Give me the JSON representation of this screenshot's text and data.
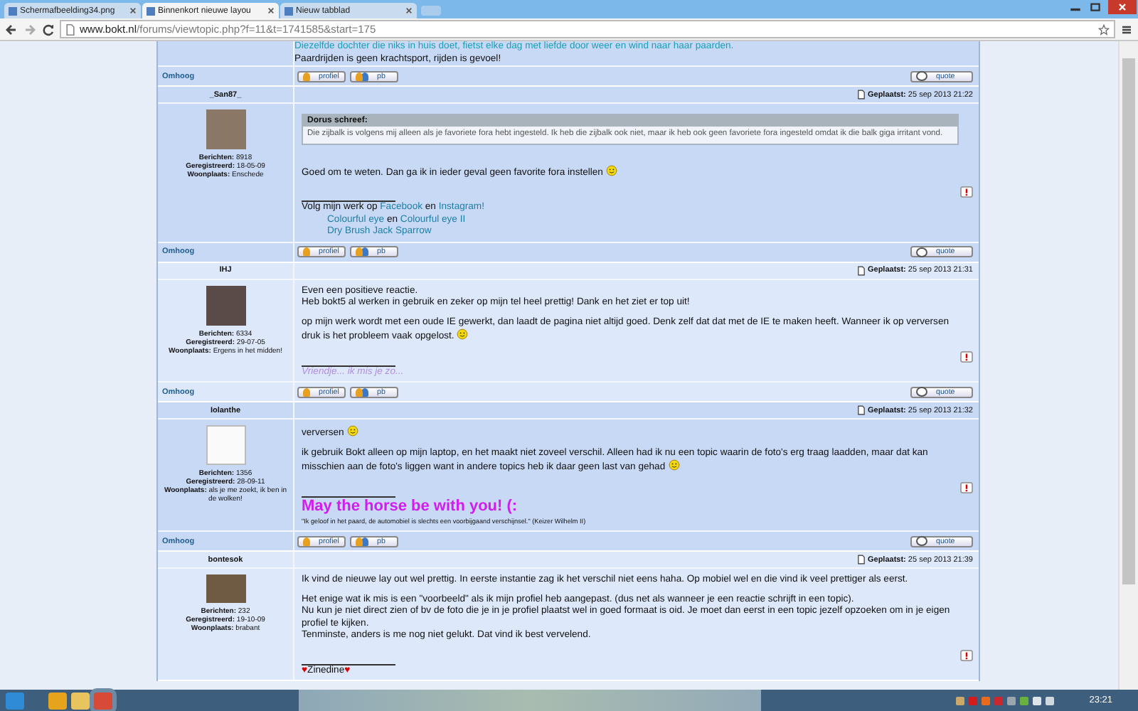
{
  "browser": {
    "tabs": [
      {
        "title": "Schermafbeelding34.png",
        "selected": false
      },
      {
        "title": "Binnenkort nieuwe layou",
        "selected": true
      },
      {
        "title": "Nieuw tabblad",
        "selected": false
      }
    ],
    "url": {
      "host": "www.bokt.nl",
      "path": "/forums/viewtopic.php?f=11&t=1741585&start=175"
    }
  },
  "top_fragment": {
    "signature": [
      [
        {
          "kind": "link",
          "text": "Diezelfde dochter die niks in huis doet, fietst elke dag met liefde door weer en wind naar haar paarden."
        }
      ],
      [
        {
          "kind": "plain",
          "text": "Paardrijden is geen krachtsport, rijden is gevoel!"
        }
      ]
    ],
    "footer": {
      "top_link": "Omhoog",
      "buttons": [
        "profiel",
        "pb"
      ],
      "quote": "quote"
    }
  },
  "posts": [
    {
      "author": "_San87_",
      "posted_label": "Geplaatst:",
      "posted_at": "25 sep 2013 21:22",
      "stats": [
        {
          "label": "Berichten:",
          "value": "8918"
        },
        {
          "label": "Geregistreerd:",
          "value": "18-05-09"
        },
        {
          "label": "Woonplaats:",
          "value": "Enschede"
        }
      ],
      "quote": {
        "header": "Dorus schreef:",
        "text": "Die zijbalk is volgens mij alleen als je favoriete fora hebt ingesteld. Ik heb die zijbalk ook niet, maar ik heb ook geen favoriete fora ingesteld omdat ik die balk giga irritant vond."
      },
      "paragraphs": [
        {
          "text": "Goed om te weten. Dan ga ik in ieder geval geen favorite fora instellen",
          "emoticon": true
        }
      ],
      "signature": [
        [
          {
            "kind": "plain",
            "text": "Volg mijn werk op "
          },
          {
            "kind": "link",
            "text": "Facebook"
          },
          {
            "kind": "plain",
            "text": " en "
          },
          {
            "kind": "link",
            "text": "Instagram!"
          }
        ],
        [
          {
            "kind": "indent"
          },
          {
            "kind": "link",
            "text": "Colourful eye"
          },
          {
            "kind": "plain",
            "text": " en "
          },
          {
            "kind": "link",
            "text": "Colourful eye II"
          }
        ],
        [
          {
            "kind": "indent"
          },
          {
            "kind": "link",
            "text": "Dry Brush Jack Sparrow"
          }
        ]
      ],
      "footer": {
        "top_link": "Omhoog",
        "buttons": [
          "profiel",
          "pb"
        ],
        "quote": "quote"
      }
    },
    {
      "author": "IHJ",
      "posted_label": "Geplaatst:",
      "posted_at": "25 sep 2013 21:31",
      "stats": [
        {
          "label": "Berichten:",
          "value": "6334"
        },
        {
          "label": "Geregistreerd:",
          "value": "29-07-05"
        },
        {
          "label": "Woonplaats:",
          "value": "Ergens in het midden!"
        }
      ],
      "paragraphs": [
        {
          "text": "Even een positieve reactie.\nHeb bokt5 al werken in gebruik en zeker op mijn tel heel prettig! Dank en het ziet er top uit!",
          "emoticon": false
        },
        {
          "text": "op mijn werk wordt met een oude IE gewerkt, dan laadt de pagina niet altijd goed. Denk zelf dat dat met de IE te maken heeft. Wanneer ik op verversen druk is het probleem vaak opgelost.",
          "emoticon": true
        }
      ],
      "signature": [
        [
          {
            "kind": "faded",
            "text": "Vriendje... ik mis je zo..."
          }
        ]
      ],
      "footer": {
        "top_link": "Omhoog",
        "buttons": [
          "profiel",
          "pb"
        ],
        "quote": "quote"
      }
    },
    {
      "author": "Iolanthe",
      "posted_label": "Geplaatst:",
      "posted_at": "25 sep 2013 21:32",
      "stats": [
        {
          "label": "Berichten:",
          "value": "1356"
        },
        {
          "label": "Geregistreerd:",
          "value": "28-09-11"
        },
        {
          "label": "Woonplaats:",
          "value": "als je me zoekt, ik ben in de wolken!"
        }
      ],
      "paragraphs": [
        {
          "text": "verversen",
          "emoticon": true
        },
        {
          "text": "ik gebruik Bokt alleen op mijn laptop, en het maakt niet zoveel verschil. Alleen had ik nu een topic waarin de foto's erg traag laadden, maar dat kan misschien aan de foto's liggen want in andere topics heb ik daar geen last van gehad",
          "emoticon": true
        }
      ],
      "signature": [
        [
          {
            "kind": "headline",
            "text": "May the horse be with you! (:"
          }
        ],
        [
          {
            "kind": "small",
            "text": "\"Ik geloof in het paard, de automobiel is slechts een voorbijgaand verschijnsel.\" (Keizer Wilhelm II)"
          }
        ]
      ],
      "footer": {
        "top_link": "Omhoog",
        "buttons": [
          "profiel",
          "pb"
        ],
        "quote": "quote"
      }
    },
    {
      "author": "bontesok",
      "posted_label": "Geplaatst:",
      "posted_at": "25 sep 2013 21:39",
      "stats": [
        {
          "label": "Berichten:",
          "value": "232"
        },
        {
          "label": "Geregistreerd:",
          "value": "19-10-09"
        },
        {
          "label": "Woonplaats:",
          "value": "brabant"
        }
      ],
      "paragraphs": [
        {
          "text": "Ik vind de nieuwe lay out wel prettig. In eerste instantie zag ik het verschil niet eens haha. Op mobiel wel en die vind ik veel prettiger als eerst.",
          "emoticon": false
        },
        {
          "text": "Het enige wat ik mis is een \"voorbeeld\" als ik mijn profiel heb aangepast. (dus net als wanneer je een reactie schrijft in een topic).\nNu kun je niet direct zien of bv de foto die je in je profiel plaatst wel in goed formaat is oid. Je moet dan eerst in een topic jezelf opzoeken om in je eigen profiel te kijken.\nTenminste, anders is me nog niet gelukt. Dat vind ik best vervelend.",
          "emoticon": false
        }
      ],
      "signature": [
        [
          {
            "kind": "heart",
            "text": "♥"
          },
          {
            "kind": "plain",
            "text": "Zinedine"
          },
          {
            "kind": "heart",
            "text": "♥"
          }
        ]
      ]
    }
  ],
  "taskbar": {
    "clock": "23:21"
  }
}
